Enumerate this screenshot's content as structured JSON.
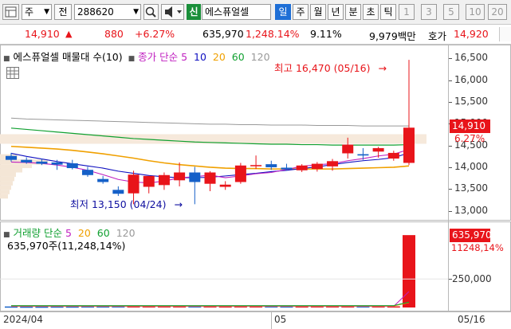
{
  "toolbar": {
    "period_select": "주",
    "prev_label": "전",
    "code": "288620",
    "badge": "신",
    "stock_name": "에스퓨얼셀",
    "periods": [
      "일",
      "주",
      "월",
      "년",
      "분",
      "초",
      "틱"
    ],
    "selected_period": "일",
    "intervals": [
      "1",
      "3",
      "5",
      "10",
      "20"
    ]
  },
  "quote": {
    "price": "14,910",
    "arrow": "▲",
    "change": "880",
    "change_pct": "+6.27%",
    "volume": "635,970",
    "volume_ratio": "1,248.14%",
    "turnover_pct": "9.11%",
    "trade_value": "9,979백만",
    "ask_label": "호가",
    "ask_price": "14,920"
  },
  "price_panel": {
    "legend_name": "에스퓨얼셀 매물대 수(10)",
    "legend_ma_title": "종가 단순",
    "ma_periods": [
      "5",
      "10",
      "20",
      "60",
      "120"
    ],
    "ma_colors": [
      "#1010c0",
      "#1010c0",
      "#f0a000",
      "#10a030",
      "#999999"
    ],
    "high_label": "최고 16,470 (05/16)",
    "low_label": "최저 13,150 (04/24)",
    "price_tag": "14,910",
    "pct_tag": "6.27%",
    "axis": [
      "16,500",
      "16,000",
      "15,500",
      "15,000",
      "14,500",
      "14,000",
      "13,500",
      "13,000"
    ]
  },
  "volume_panel": {
    "legend_title": "거래량 단순",
    "ma_periods": [
      "5",
      "20",
      "60",
      "120"
    ],
    "legend_line2": "635,970주(11,248,14%)",
    "tag_volume": "635,970",
    "tag_pct": "11248,14%",
    "axis": [
      "250,000"
    ]
  },
  "date_axis": {
    "labels": [
      "2024/04",
      "05",
      "05/16"
    ]
  },
  "chart_data": {
    "type": "candlestick",
    "ylim": [
      12900,
      16600
    ],
    "candles": [
      {
        "o": 14260,
        "h": 14330,
        "l": 14130,
        "c": 14170,
        "vol": 9000
      },
      {
        "o": 14170,
        "h": 14230,
        "l": 14080,
        "c": 14110,
        "vol": 8000
      },
      {
        "o": 14130,
        "h": 14200,
        "l": 14050,
        "c": 14080,
        "vol": 8000
      },
      {
        "o": 14110,
        "h": 14170,
        "l": 13940,
        "c": 14060,
        "vol": 9000
      },
      {
        "o": 14090,
        "h": 14170,
        "l": 13950,
        "c": 13980,
        "vol": 9000
      },
      {
        "o": 13940,
        "h": 14010,
        "l": 13780,
        "c": 13820,
        "vol": 10000
      },
      {
        "o": 13730,
        "h": 13800,
        "l": 13620,
        "c": 13660,
        "vol": 10000
      },
      {
        "o": 13480,
        "h": 13560,
        "l": 13340,
        "c": 13390,
        "vol": 11000
      },
      {
        "o": 13400,
        "h": 13920,
        "l": 13150,
        "c": 13830,
        "vol": 14000
      },
      {
        "o": 13550,
        "h": 13800,
        "l": 13400,
        "c": 13800,
        "vol": 12000
      },
      {
        "o": 13590,
        "h": 13880,
        "l": 13480,
        "c": 13820,
        "vol": 12000
      },
      {
        "o": 13700,
        "h": 14110,
        "l": 13560,
        "c": 13880,
        "vol": 13000
      },
      {
        "o": 13880,
        "h": 14010,
        "l": 13150,
        "c": 13660,
        "vol": 12000
      },
      {
        "o": 13620,
        "h": 13910,
        "l": 13450,
        "c": 13880,
        "vol": 11000
      },
      {
        "o": 13550,
        "h": 13680,
        "l": 13480,
        "c": 13600,
        "vol": 10000
      },
      {
        "o": 13660,
        "h": 14100,
        "l": 13620,
        "c": 14040,
        "vol": 14000
      },
      {
        "o": 14030,
        "h": 14270,
        "l": 13960,
        "c": 14050,
        "vol": 12000
      },
      {
        "o": 14070,
        "h": 14150,
        "l": 13940,
        "c": 14000,
        "vol": 11000
      },
      {
        "o": 13990,
        "h": 14080,
        "l": 13920,
        "c": 13950,
        "vol": 10000
      },
      {
        "o": 13930,
        "h": 14070,
        "l": 13890,
        "c": 14040,
        "vol": 10000
      },
      {
        "o": 13960,
        "h": 14120,
        "l": 13900,
        "c": 14080,
        "vol": 11000
      },
      {
        "o": 14020,
        "h": 14190,
        "l": 13920,
        "c": 14140,
        "vol": 12000
      },
      {
        "o": 14320,
        "h": 14680,
        "l": 14200,
        "c": 14520,
        "vol": 14000
      },
      {
        "o": 14300,
        "h": 14440,
        "l": 14170,
        "c": 14270,
        "vol": 11000
      },
      {
        "o": 14360,
        "h": 14470,
        "l": 14220,
        "c": 14440,
        "vol": 11000
      },
      {
        "o": 14200,
        "h": 14380,
        "l": 14150,
        "c": 14330,
        "vol": 10000
      },
      {
        "o": 14100,
        "h": 16470,
        "l": 14050,
        "c": 14910,
        "vol": 635970
      }
    ],
    "ma5": [
      14120,
      14110,
      14090,
      14050,
      14000,
      13930,
      13830,
      13720,
      13660,
      13640,
      13680,
      13760,
      13780,
      13820,
      13760,
      13800,
      13850,
      13880,
      13950,
      14020,
      14060,
      14080,
      14150,
      14200,
      14260,
      14300,
      14410
    ],
    "ma10": [
      14320,
      14250,
      14190,
      14130,
      14080,
      14030,
      13980,
      13910,
      13860,
      13810,
      13780,
      13760,
      13760,
      13770,
      13800,
      13830,
      13860,
      13900,
      13930,
      13970,
      14010,
      14060,
      14110,
      14150,
      14180,
      14220,
      14330
    ],
    "ma20": [
      14480,
      14460,
      14440,
      14420,
      14390,
      14350,
      14310,
      14260,
      14210,
      14150,
      14100,
      14060,
      14030,
      14000,
      13980,
      13970,
      13970,
      13960,
      13960,
      13960,
      13960,
      13960,
      13970,
      13980,
      13990,
      14000,
      14030
    ],
    "ma60": [
      14900,
      14870,
      14840,
      14810,
      14780,
      14750,
      14720,
      14690,
      14660,
      14640,
      14620,
      14600,
      14580,
      14570,
      14560,
      14550,
      14540,
      14530,
      14530,
      14520,
      14520,
      14510,
      14510,
      14510,
      14510,
      14510,
      14520
    ],
    "ma120": [
      15130,
      15110,
      15100,
      15090,
      15080,
      15070,
      15060,
      15050,
      15040,
      15030,
      15020,
      15010,
      15000,
      14990,
      14990,
      14980,
      14980,
      14970,
      14970,
      14970,
      14960,
      14960,
      14960,
      14950,
      14950,
      14950,
      14950
    ],
    "volume_ylim": [
      0,
      700000
    ]
  },
  "colors": {
    "up": "#e8141a",
    "down": "#1560c8",
    "accent": "#1f6fd6"
  }
}
